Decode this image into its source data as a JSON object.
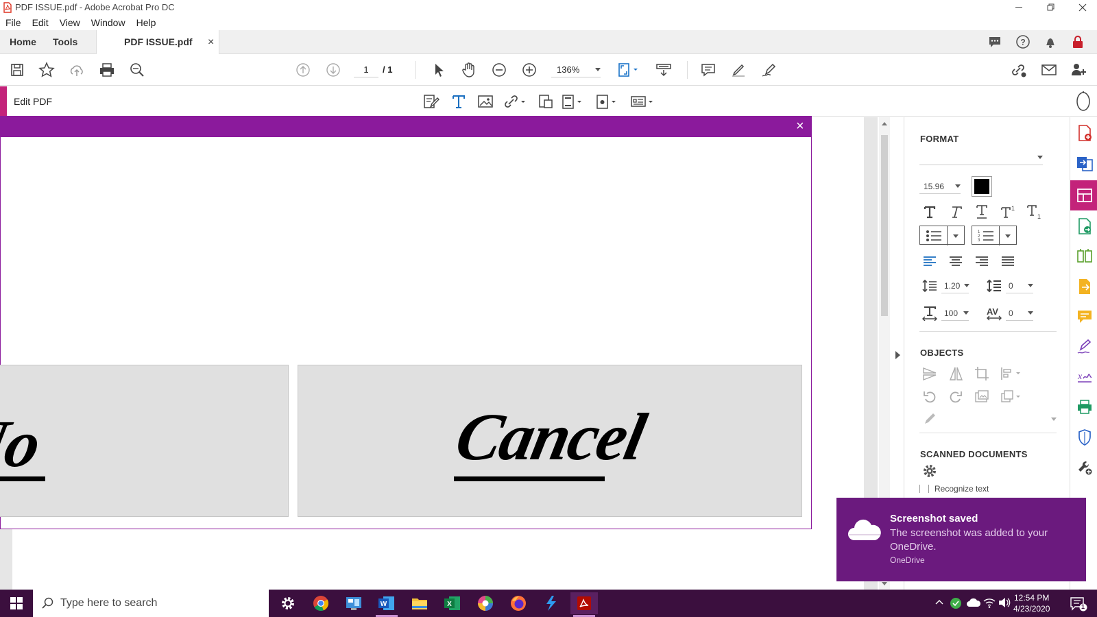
{
  "window": {
    "title": "PDF ISSUE.pdf - Adobe Acrobat Pro DC"
  },
  "menu": [
    "File",
    "Edit",
    "View",
    "Window",
    "Help"
  ],
  "tabs": {
    "home": "Home",
    "tools": "Tools",
    "doc": "PDF ISSUE.pdf",
    "close": "×"
  },
  "toolbar": {
    "page_current": "1",
    "page_total": "/ 1",
    "zoom": "136%"
  },
  "edit_bar": {
    "label": "Edit PDF"
  },
  "dialog": {
    "close": "×",
    "button_left_label": "No",
    "button_right_label": "Cancel"
  },
  "format_panel": {
    "format_header": "FORMAT",
    "font_name": "",
    "font_size": "15.96",
    "font_color": "#000000",
    "line_spacing": "1.20",
    "paragraph_spacing": "0",
    "horizontal_scale": "100",
    "char_spacing": "0",
    "objects_header": "OBJECTS",
    "scanned_header": "SCANNED DOCUMENTS",
    "scanned_checkbox_label": "Recognize text"
  },
  "toast": {
    "title": "Screenshot saved",
    "body": "The screenshot was added to your OneDrive.",
    "source": "OneDrive"
  },
  "taskbar": {
    "search_placeholder": "Type here to search",
    "time": "12:54 PM",
    "date": "4/23/2020",
    "notification_count": "1"
  },
  "colors": {
    "accent_purple": "#8b1a9c",
    "taskbar": "#3b0f3e",
    "toast": "#6b1a7e",
    "edit_accent": "#c3237a"
  }
}
